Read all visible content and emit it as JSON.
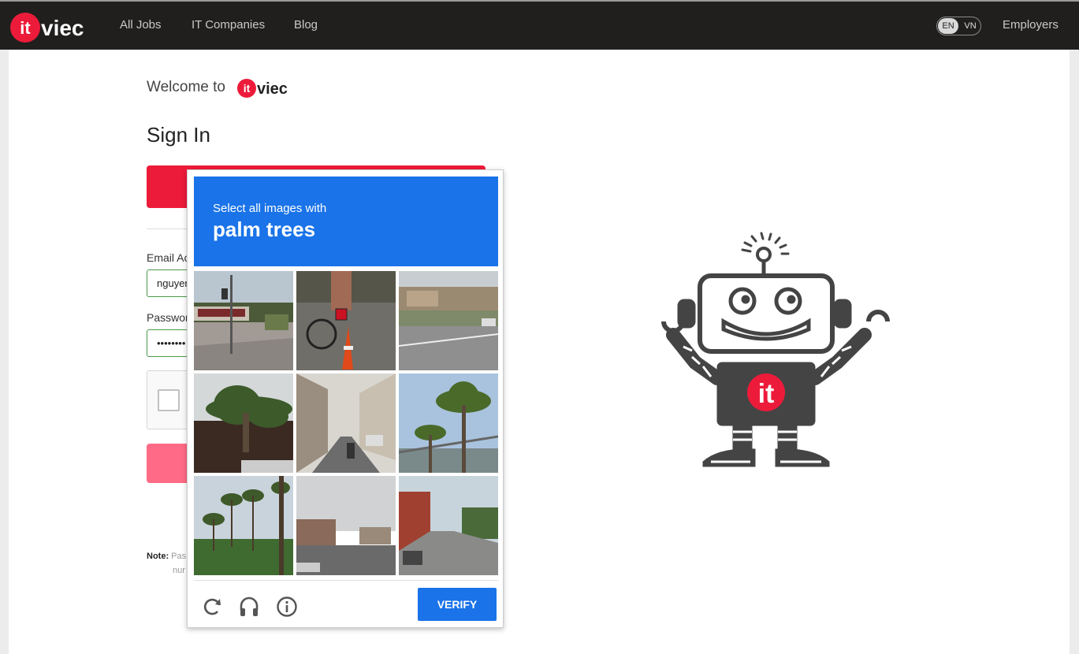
{
  "nav": {
    "logo_text": "itviec",
    "links": [
      "All Jobs",
      "IT Companies",
      "Blog"
    ],
    "lang_active": "EN",
    "lang_other": "VN",
    "employers": "Employers"
  },
  "login": {
    "welcome": "Welcome to",
    "welcome_logo_text": "itviec",
    "title": "Sign In",
    "email_label": "Email Ac",
    "email_value": "nguyen",
    "password_label": "Passwor",
    "password_value": "••••••••",
    "note_bold": "Note:",
    "note_text": "Pas",
    "note_text2": "nur"
  },
  "captcha": {
    "instruction": "Select all images with",
    "target": "palm trees",
    "verify_label": "VERIFY",
    "icons": [
      "reload-icon",
      "audio-icon",
      "info-icon"
    ]
  },
  "robot_badge": "it",
  "colors": {
    "brand_red": "#ed1b3a",
    "captcha_blue": "#1a73e8",
    "nav_bg": "#201f1e"
  }
}
